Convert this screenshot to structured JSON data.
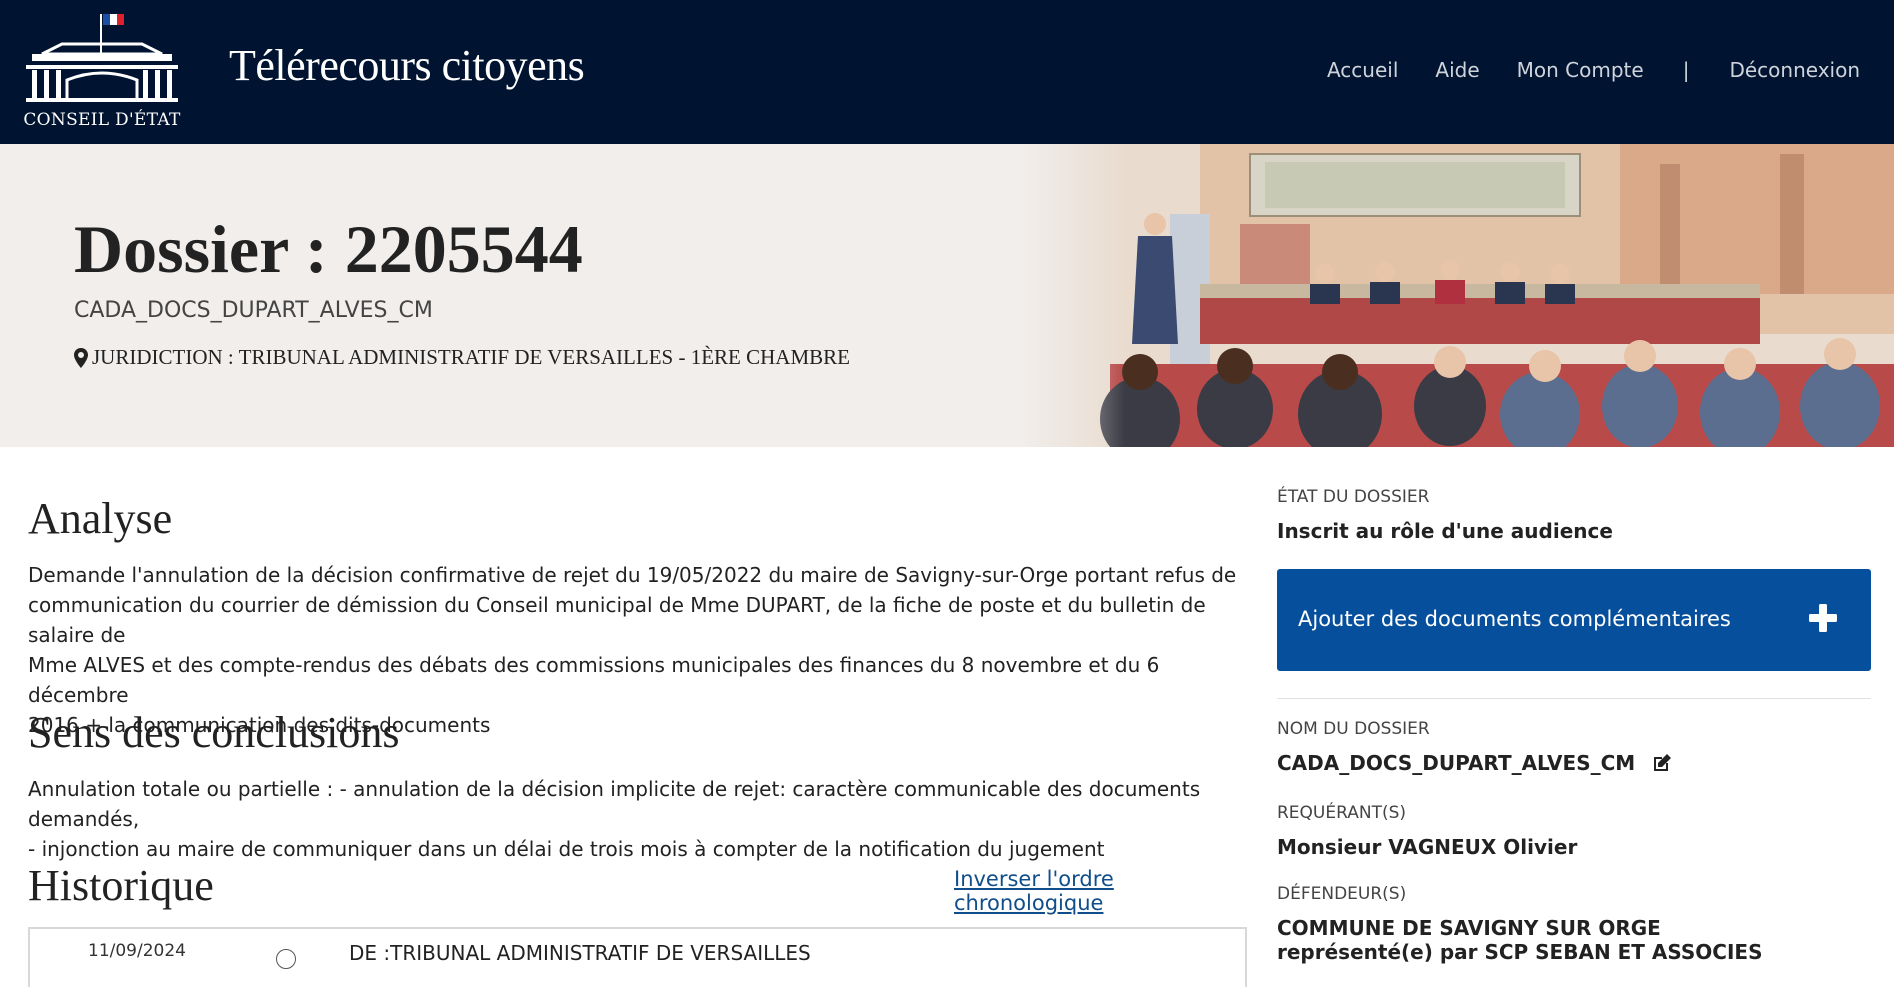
{
  "header": {
    "logo_text": "CONSEIL D'ÉTAT",
    "app_title": "Télérecours citoyens",
    "nav": {
      "home": "Accueil",
      "help": "Aide",
      "account": "Mon Compte",
      "separator": "|",
      "logout": "Déconnexion"
    }
  },
  "hero": {
    "title": "Dossier : 2205544",
    "reference": "CADA_DOCS_DUPART_ALVES_CM",
    "juridiction": "JURIDICTION : TRIBUNAL ADMINISTRATIF DE VERSAILLES - 1ÈRE CHAMBRE"
  },
  "main": {
    "analyse_title": "Analyse",
    "analyse_lines": [
      "Demande l'annulation de la décision confirmative de rejet du 19/05/2022 du maire de Savigny-sur-Orge portant refus de",
      "communication du courrier de démission du Conseil municipal de Mme DUPART, de la fiche de poste et du bulletin de salaire de",
      "Mme ALVES et des compte-rendus des débats des commissions municipales des finances du 8 novembre et du 6 décembre",
      "2016 + la communication des dits-documents"
    ],
    "conclusions_title": "Sens des conclusions",
    "conclusions_lines": [
      "Annulation totale ou partielle : - annulation de la décision implicite de rejet: caractère communicable des documents demandés,",
      "- injonction au maire de communiquer dans un délai de trois mois à compter de la notification du jugement"
    ],
    "historique_title": "Historique",
    "invert_link": "Inverser l'ordre chronologique",
    "history": [
      {
        "date": "11/09/2024",
        "from": "DE :TRIBUNAL ADMINISTRATIF DE VERSAILLES"
      }
    ]
  },
  "sidebar": {
    "etat_label": "ÉTAT DU DOSSIER",
    "etat_value": "Inscrit au rôle d'une audience",
    "add_button": "Ajouter des documents complémentaires",
    "nom_label": "NOM DU DOSSIER",
    "nom_value": "CADA_DOCS_DUPART_ALVES_CM",
    "requerant_label": "REQUÉRANT(S)",
    "requerant_value": "Monsieur VAGNEUX Olivier",
    "defendeur_label": "DÉFENDEUR(S)",
    "defendeur_value_1": "COMMUNE DE SAVIGNY SUR ORGE",
    "defendeur_value_2": "représenté(e) par SCP SEBAN ET ASSOCIES"
  },
  "colors": {
    "header_bg": "#001330",
    "hero_bg": "#f1eeec",
    "button_bg": "#064f9c",
    "link": "#104e8b"
  },
  "icons": {
    "logo": "conseil-etat-building-icon",
    "location": "map-pin-icon",
    "add": "plus-icon",
    "edit": "edit-icon",
    "timeline": "timeline-dot-icon"
  }
}
